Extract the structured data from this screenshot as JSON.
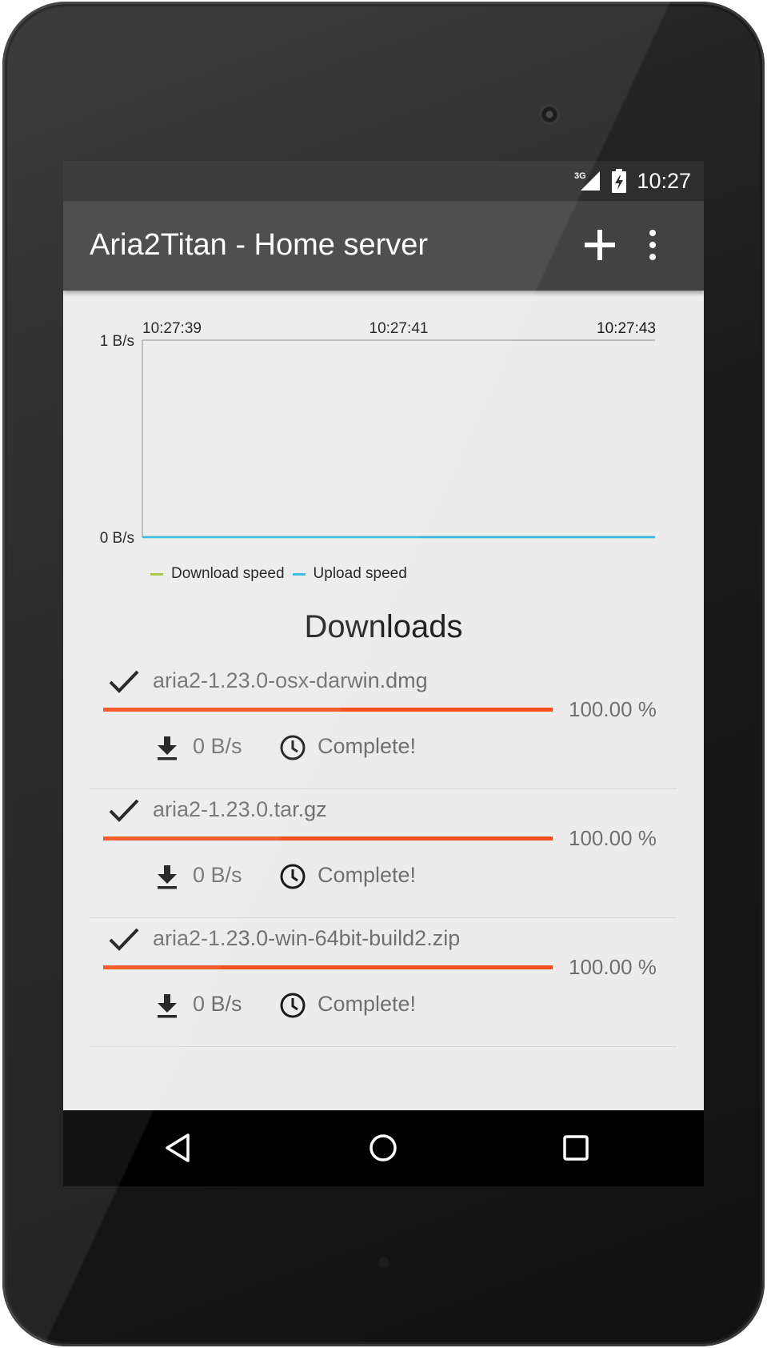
{
  "status_bar": {
    "network": "3G",
    "time": "10:27"
  },
  "app_bar": {
    "title": "Aria2Titan - Home server",
    "add_icon": "plus-icon",
    "menu_icon": "more-vert-icon"
  },
  "chart_data": {
    "type": "line",
    "x": [
      "10:27:39",
      "10:27:41",
      "10:27:43"
    ],
    "ytick_labels": [
      "1 B/s",
      "0 B/s"
    ],
    "ylim": [
      0,
      1
    ],
    "series": [
      {
        "name": "Download speed",
        "color": "#a4c639",
        "values": [
          0,
          0,
          0
        ]
      },
      {
        "name": "Upload speed",
        "color": "#33b5e5",
        "values": [
          0,
          0,
          0
        ]
      }
    ],
    "legend_position": "bottom-left",
    "grid": false
  },
  "downloads": {
    "title": "Downloads",
    "items": [
      {
        "name": "aria2-1.23.0-osx-darwin.dmg",
        "progress": 1.0,
        "percent": "100.00 %",
        "speed": "0 B/s",
        "status": "Complete!"
      },
      {
        "name": "aria2-1.23.0.tar.gz",
        "progress": 1.0,
        "percent": "100.00 %",
        "speed": "0 B/s",
        "status": "Complete!"
      },
      {
        "name": "aria2-1.23.0-win-64bit-build2.zip",
        "progress": 1.0,
        "percent": "100.00 %",
        "speed": "0 B/s",
        "status": "Complete!"
      }
    ]
  },
  "colors": {
    "accent": "#f4511e",
    "app_bar": "#424242",
    "status_bar": "#2e2e2e"
  },
  "nav": {
    "back_icon": "back-triangle-icon",
    "home_icon": "home-circle-icon",
    "recents_icon": "recents-square-icon"
  }
}
